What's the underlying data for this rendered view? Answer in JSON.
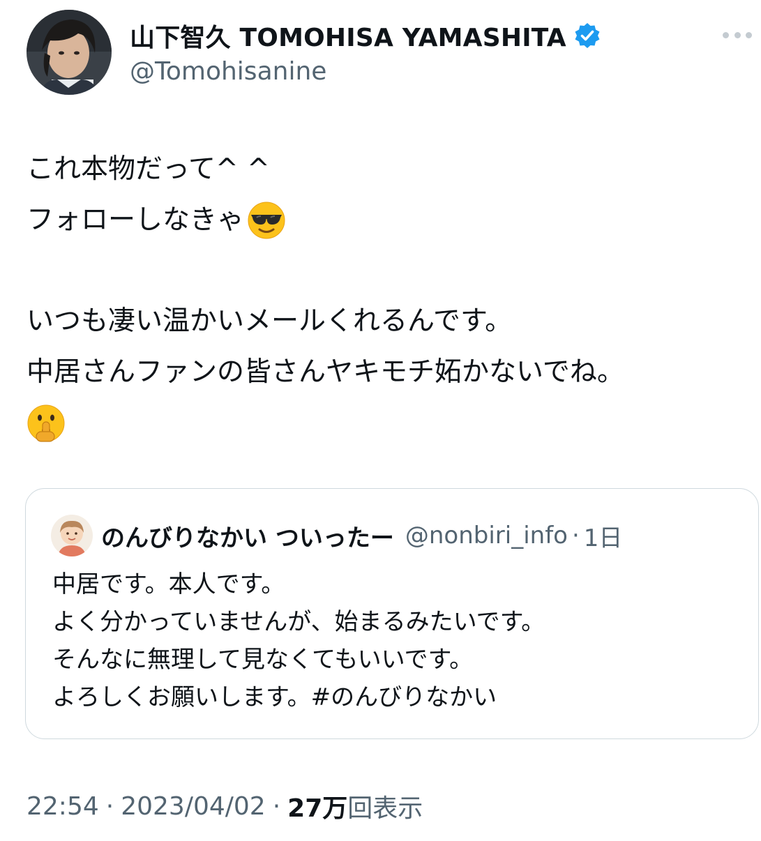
{
  "author": {
    "display_name": "山下智久 TOMOHISA YAMASHITA",
    "handle": "@Tomohisanine",
    "verified": true,
    "avatar_icon": "profile-photo"
  },
  "tweet": {
    "lines": [
      "これ本物だって^ ^",
      "フォローしなきゃ",
      "",
      "いつも凄い温かいメールくれるんです。",
      "中居さんファンの皆さんヤキモチ妬かないでね。"
    ],
    "emojis": [
      "smiling-face-with-sunglasses-icon",
      "shushing-face-icon"
    ]
  },
  "quoted_tweet": {
    "display_name": "のんびりなかい ついったー",
    "handle": "@nonbiri_info",
    "separator": "·",
    "time": "1日",
    "lines": [
      "中居です。本人です。",
      "よく分かっていませんが、始まるみたいです。",
      "そんなに無理して見なくてもいいです。",
      "よろしくお願いします。#のんびりなかい"
    ]
  },
  "meta": {
    "time": "22:54",
    "separator": "·",
    "date": "2023/04/02",
    "views_count": "27万",
    "views_label": "回表示"
  },
  "colors": {
    "text": "#0f1419",
    "secondary": "#536471",
    "verified": "#1d9bf0",
    "border": "#cfd9de"
  }
}
